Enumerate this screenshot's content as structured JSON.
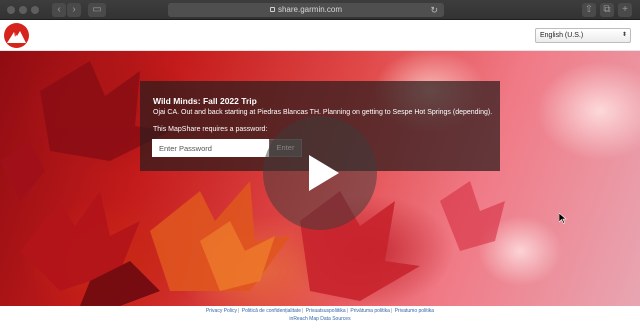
{
  "browser": {
    "url": "share.garmin.com",
    "icons": [
      "back-icon",
      "forward-icon",
      "sidebar-icon",
      "privacy-shield-icon",
      "reload-icon",
      "share-icon",
      "tabs-icon",
      "new-tab-icon"
    ]
  },
  "header": {
    "logo": "garmin-mountain-logo",
    "language": "English (U.S.)"
  },
  "trip": {
    "title": "Wild Minds: Fall 2022 Trip",
    "description": "Ojai CA. Out and back starting at Piedras Blancas TH. Planning on getting to Sespe Hot Springs (depending).",
    "password_prompt": "This MapShare requires a password:",
    "password_placeholder": "Enter Password",
    "enter_label": "Enter"
  },
  "footer": {
    "links": [
      "Privacy Policy",
      "Politică de confidențialitate",
      "Privaatsuspoliitika",
      "Privātuma politika",
      "Privatumo politika"
    ],
    "data_sources": "inReach Map Data Sources"
  },
  "colors": {
    "garmin_red": "#d6241c",
    "link_blue": "#3366aa"
  }
}
